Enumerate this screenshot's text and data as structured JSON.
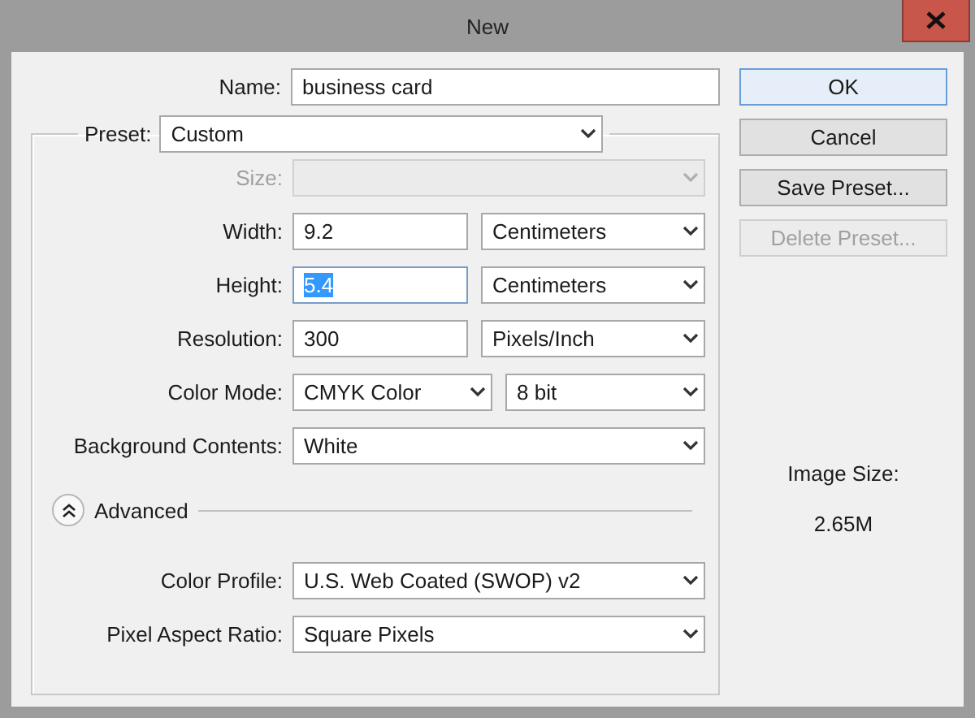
{
  "window": {
    "title": "New"
  },
  "name": {
    "label": "Name:",
    "value": "business card"
  },
  "preset": {
    "label": "Preset:",
    "value": "Custom"
  },
  "rows": [
    {
      "label": "Size:",
      "disabled": true,
      "controls": [
        {
          "kind": "select",
          "disabled": true
        }
      ]
    },
    {
      "label": "Width:",
      "disabled": false,
      "controls": [
        {
          "kind": "input",
          "value": "9.2",
          "text_selected": false
        },
        {
          "kind": "select",
          "value": "Centimeters",
          "disabled": false
        }
      ]
    },
    {
      "label": "Height:",
      "disabled": false,
      "controls": [
        {
          "kind": "input",
          "value": "5.4",
          "text_selected": true
        },
        {
          "kind": "select",
          "value": "Centimeters",
          "disabled": false
        }
      ]
    },
    {
      "label": "Resolution:",
      "disabled": false,
      "controls": [
        {
          "kind": "input",
          "value": "300",
          "text_selected": false
        },
        {
          "kind": "select",
          "value": "Pixels/Inch",
          "disabled": false
        }
      ]
    },
    {
      "label": "Color Mode:",
      "disabled": false,
      "controls": [
        {
          "kind": "select",
          "value": "CMYK Color",
          "disabled": false
        },
        {
          "kind": "select",
          "value": "8 bit",
          "disabled": false
        }
      ]
    },
    {
      "label": "Background Contents:",
      "disabled": false,
      "controls": [
        {
          "kind": "select",
          "value": "White",
          "disabled": false
        }
      ]
    }
  ],
  "advanced": {
    "label": "Advanced",
    "expanded": true
  },
  "advanced_rows": [
    {
      "label": "Color Profile:",
      "disabled": false,
      "controls": [
        {
          "kind": "select",
          "value": "U.S. Web Coated (SWOP) v2",
          "disabled": false
        }
      ]
    },
    {
      "label": "Pixel Aspect Ratio:",
      "disabled": false,
      "controls": [
        {
          "kind": "select",
          "value": "Square Pixels",
          "disabled": false
        }
      ]
    }
  ],
  "buttons": [
    {
      "label": "OK",
      "default": true,
      "disabled": false
    },
    {
      "label": "Cancel",
      "default": false,
      "disabled": false
    },
    {
      "label": "Save Preset...",
      "default": false,
      "disabled": false
    },
    {
      "label": "Delete Preset...",
      "default": false,
      "disabled": true
    }
  ],
  "image_size": {
    "label": "Image Size:",
    "value": "2.65M"
  }
}
